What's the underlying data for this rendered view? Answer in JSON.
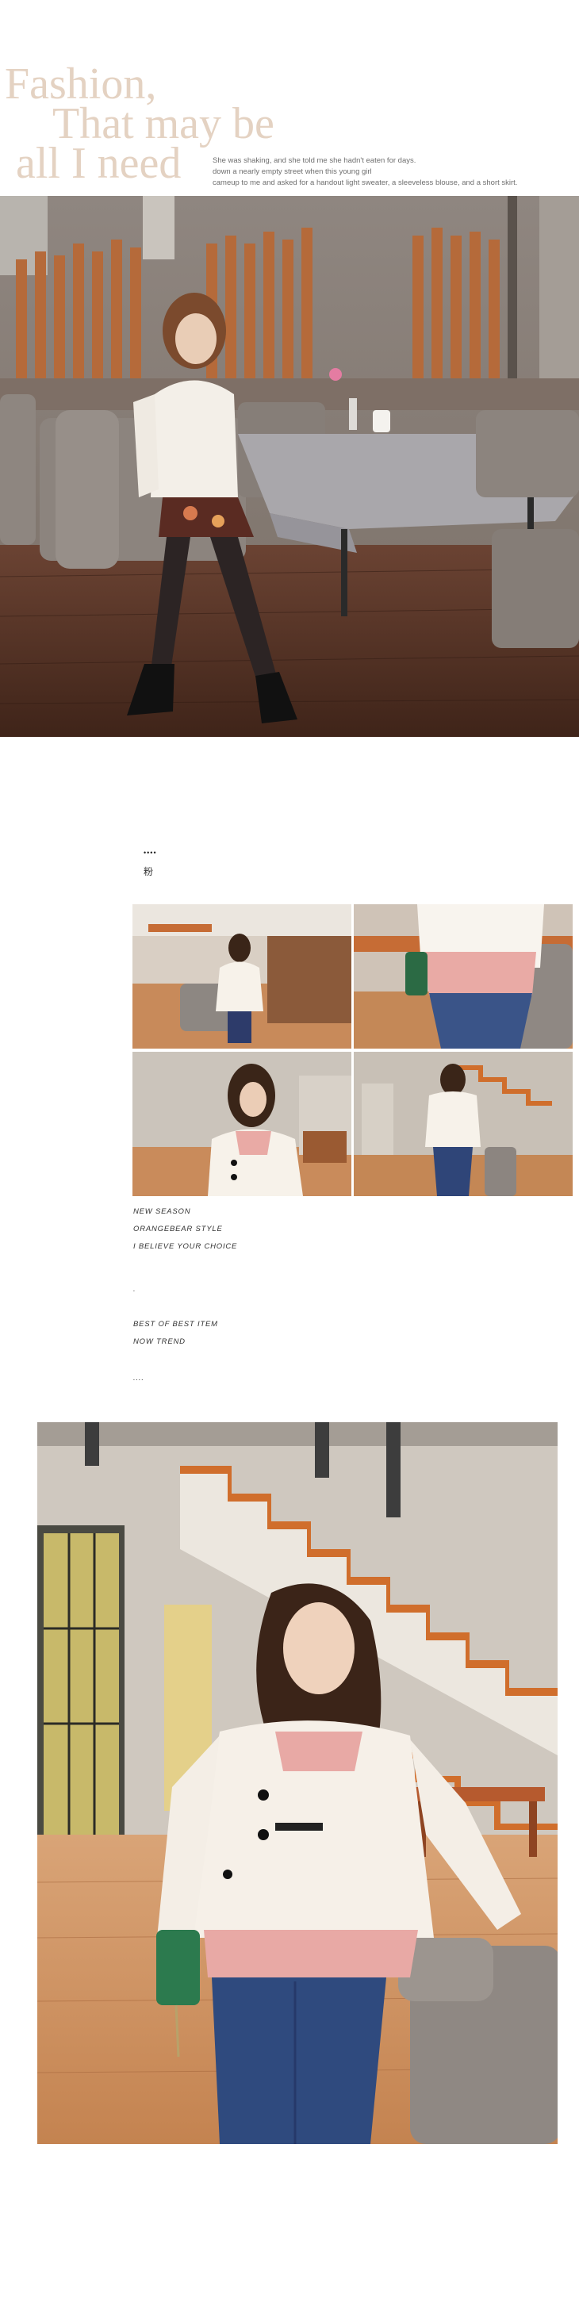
{
  "header": {
    "title_lines": [
      "Fashion,",
      "That may be",
      "all I need"
    ],
    "description_lines": [
      "She was shaking,  and she told me she hadn't eaten for days.",
      "down a nearly empty street when this young girl",
      "cameup to me and asked for a handout light sweater, a sleeveless blouse, and a short skirt."
    ]
  },
  "section": {
    "dots": "••••",
    "label": "粉"
  },
  "captions": {
    "line1": "NEW SEASON",
    "line2": "ORANGEBEAR STYLE",
    "line3": "I BELIEVE YOUR CHOICE",
    "line4": ".",
    "line5": "BEST OF BEST ITEM",
    "line6": "NOW TREND",
    "line7": "...."
  },
  "colors": {
    "title": "#e4d2c2",
    "cardigan": "#f6f0e8",
    "blouse_pink": "#e8a9a5",
    "stair_orange": "#d06e2c",
    "table_cloth": "#a9a7ab",
    "floor_wood": "#5a3424"
  }
}
